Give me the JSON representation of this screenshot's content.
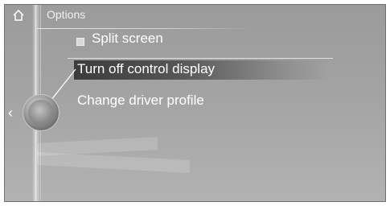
{
  "header": {
    "title": "Options"
  },
  "menu": {
    "items": [
      {
        "label": "Split screen",
        "checkbox": true,
        "checked": false
      },
      {
        "label": "Turn off control display",
        "selected": true
      },
      {
        "label": "Change driver profile"
      }
    ]
  },
  "icons": {
    "home": "home-icon",
    "back": "chevron-left-icon"
  }
}
